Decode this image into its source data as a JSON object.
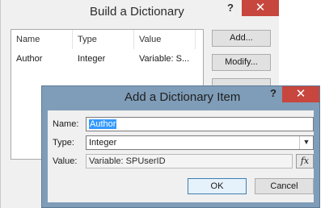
{
  "background_dialog": {
    "title": "Build a Dictionary",
    "help_glyph": "?",
    "close_glyph": "✕",
    "columns": [
      "Name",
      "Type",
      "Value"
    ],
    "rows": [
      {
        "name": "Author",
        "type": "Integer",
        "value": "Variable: S..."
      }
    ],
    "buttons": {
      "add": "Add...",
      "modify": "Modify..."
    }
  },
  "dialog": {
    "title": "Add a Dictionary Item",
    "help_glyph": "?",
    "close_glyph": "✕",
    "name_label": "Name:",
    "name_value": "Author",
    "type_label": "Type:",
    "type_value": "Integer",
    "value_label": "Value:",
    "value_value": "Variable: SPUserID",
    "fx_label": "fx",
    "ok_label": "OK",
    "cancel_label": "Cancel"
  },
  "colors": {
    "close_red": "#c7463d",
    "dialog_frame": "#7f9db8",
    "selection_blue": "#3399ff"
  }
}
